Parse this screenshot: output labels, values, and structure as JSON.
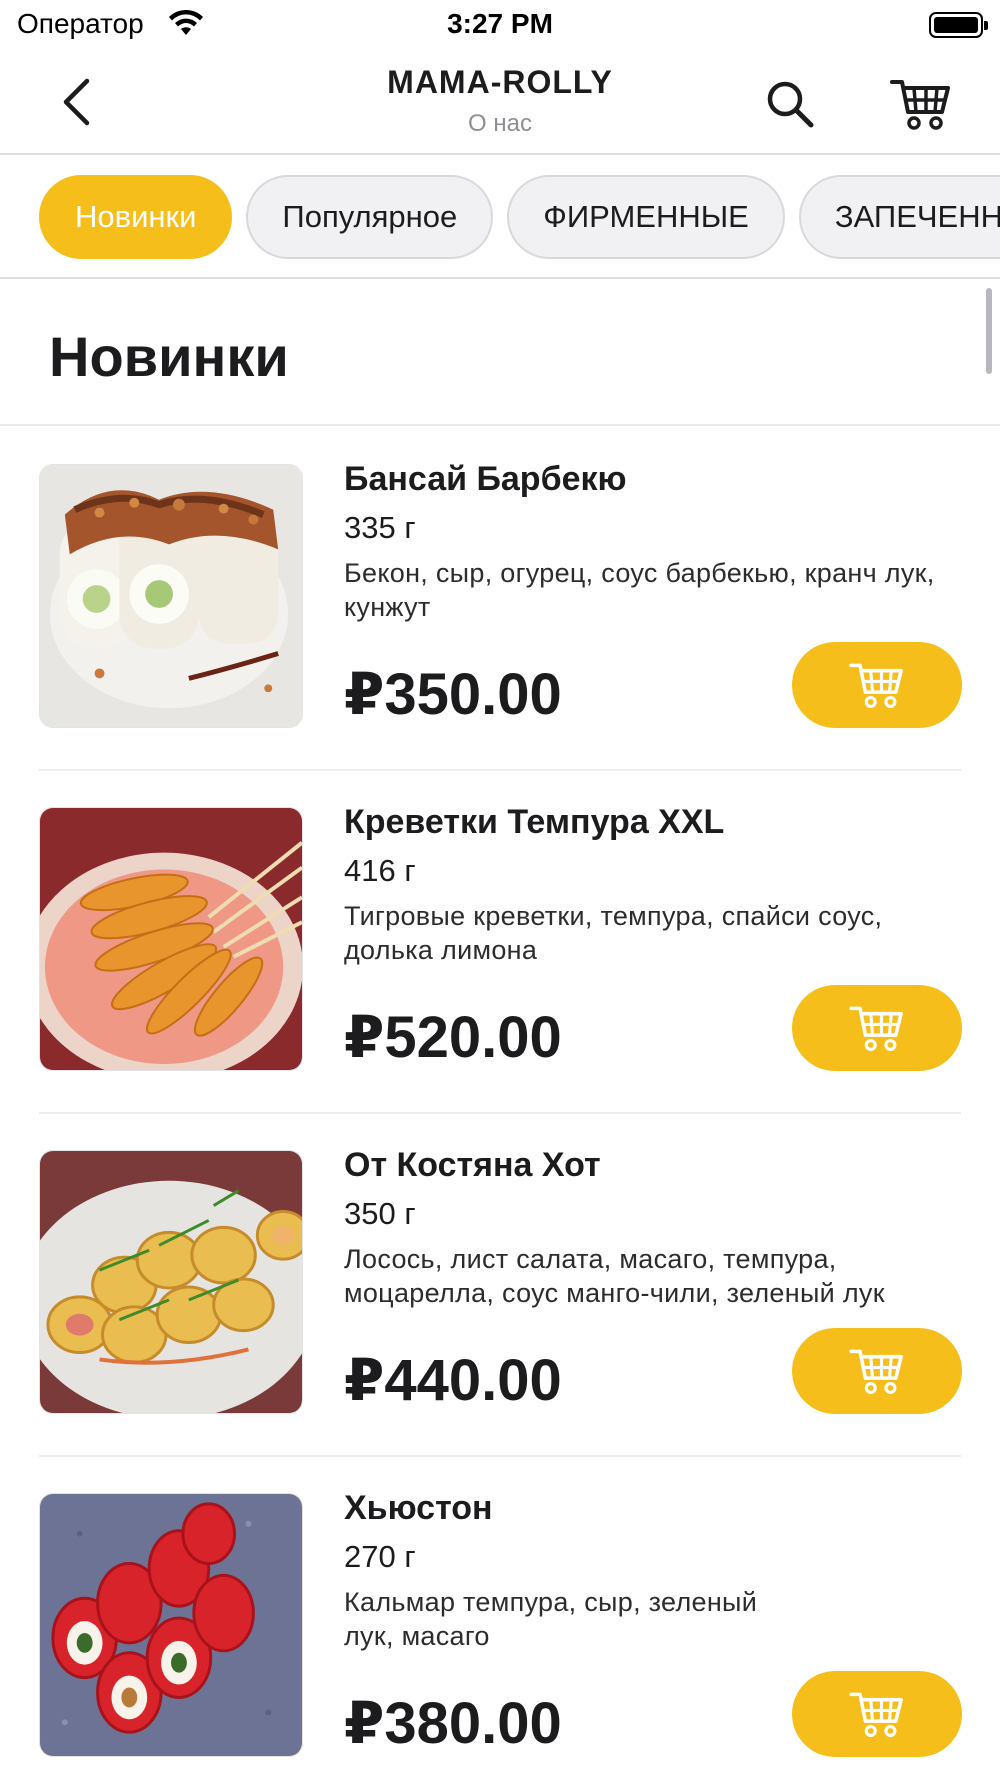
{
  "status_bar": {
    "carrier": "Оператор",
    "time": "3:27 PM"
  },
  "nav": {
    "title": "MAMA-ROLLY",
    "subtitle": "О нас",
    "icons": [
      "back-chevron-icon",
      "search-icon",
      "cart-icon"
    ]
  },
  "categories": [
    {
      "label": "Новинки",
      "active": true
    },
    {
      "label": "Популярное",
      "active": false
    },
    {
      "label": "ФИРМЕННЫЕ",
      "active": false
    },
    {
      "label": "ЗАПЕЧЕННЫЕ",
      "active": false
    }
  ],
  "section": {
    "title": "Новинки"
  },
  "products": [
    {
      "name": "Бансай Барбекю",
      "weight": "335 г",
      "description": "Бекон, сыр, огурец, соус барбекью, кранч лук, кунжут",
      "price": "₽350.00"
    },
    {
      "name": "Креветки Темпура XXL",
      "weight": "416 г",
      "description": "Тигровые креветки, темпура, спайси соус, долька лимона",
      "price": "₽520.00"
    },
    {
      "name": "От Костяна Хот",
      "weight": "350 г",
      "description": "Лосось, лист салата, масаго, темпура, моцарелла, соус манго-чили, зеленый лук",
      "price": "₽440.00"
    },
    {
      "name": "Хьюстон",
      "weight": "270 г",
      "description": "Кальмар темпура, сыр, зеленый лук, масаго",
      "price": "₽380.00"
    }
  ],
  "colors": {
    "accent": "#f5be1b",
    "chip_bg": "#f1f1f3",
    "text": "#1c1c1e",
    "muted": "#8e8e93"
  }
}
